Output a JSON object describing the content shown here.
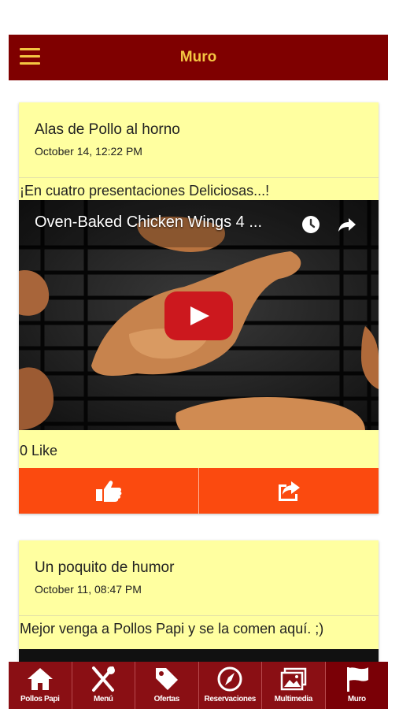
{
  "header": {
    "title": "Muro",
    "menu_icon": "hamburger-icon"
  },
  "colors": {
    "header_bg": "#7f0000",
    "header_text": "#f4c542",
    "card_bg": "#ffffa0",
    "action_bg": "#fb4a0f",
    "tab_bg": "#8a0f14"
  },
  "posts": [
    {
      "title": "Alas de Pollo al horno",
      "date": "October 14, 12:22 PM",
      "text": "¡En cuatro presentaciones Deliciosas...!",
      "video_title": "Oven-Baked Chicken Wings 4 ...",
      "likes": "0 Like"
    },
    {
      "title": "Un poquito de humor",
      "date": "October 11, 08:47 PM",
      "text": "Mejor venga a Pollos Papi y se la comen aquí. ;)"
    }
  ],
  "tabs": [
    {
      "label": "Pollos Papi",
      "icon": "home-icon"
    },
    {
      "label": "Menú",
      "icon": "utensils-icon"
    },
    {
      "label": "Ofertas",
      "icon": "tag-icon"
    },
    {
      "label": "Reservaciones",
      "icon": "compass-icon"
    },
    {
      "label": "Multimedia",
      "icon": "gallery-icon"
    },
    {
      "label": "Muro",
      "icon": "flag-icon",
      "active": true
    }
  ]
}
